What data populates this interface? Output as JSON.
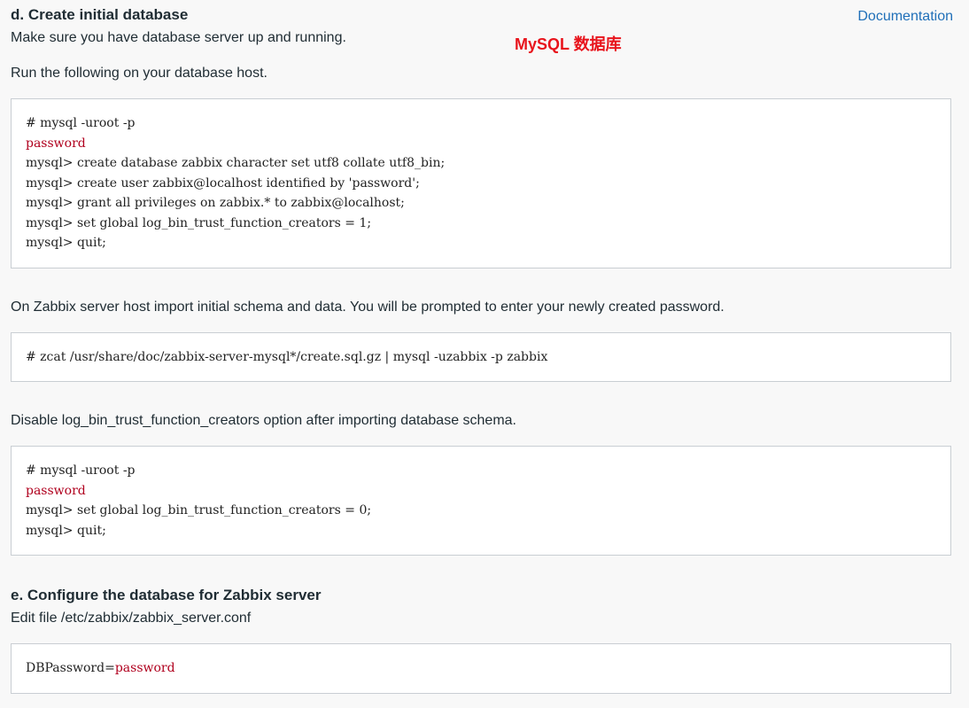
{
  "section_d": {
    "title": "d. Create initial database",
    "documentation_link": "Documentation",
    "annotation": "MySQL 数据库",
    "intro": "Make sure you have database server up and running.",
    "run_text": "Run the following on your database host.",
    "code_block_1": {
      "line_1": "# mysql -uroot -p",
      "line_2": "password",
      "line_3": "mysql> create database zabbix character set utf8 collate utf8_bin;",
      "line_4": "mysql> create user zabbix@localhost identified by 'password';",
      "line_5": "mysql> grant all privileges on zabbix.* to zabbix@localhost;",
      "line_6": "mysql> set global log_bin_trust_function_creators = 1;",
      "line_7": "mysql> quit;"
    },
    "import_text": "On Zabbix server host import initial schema and data. You will be prompted to enter your newly created password.",
    "code_block_2": {
      "line_1": "# zcat /usr/share/doc/zabbix-server-mysql*/create.sql.gz | mysql -uzabbix -p zabbix"
    },
    "disable_text": "Disable log_bin_trust_function_creators option after importing database schema.",
    "code_block_3": {
      "line_1": "# mysql -uroot -p",
      "line_2": "password",
      "line_3": "mysql> set global log_bin_trust_function_creators = 0;",
      "line_4": "mysql> quit;"
    }
  },
  "section_e": {
    "title": "e. Configure the database for Zabbix server",
    "edit_text": "Edit file /etc/zabbix/zabbix_server.conf",
    "code_block": {
      "key": "DBPassword=",
      "value": "password"
    }
  },
  "colors": {
    "background": "#f8f8f8",
    "link": "#1f6fb8",
    "annotation": "#e8141c",
    "code_highlight": "#b0001e",
    "code_border": "#c9ced3"
  }
}
